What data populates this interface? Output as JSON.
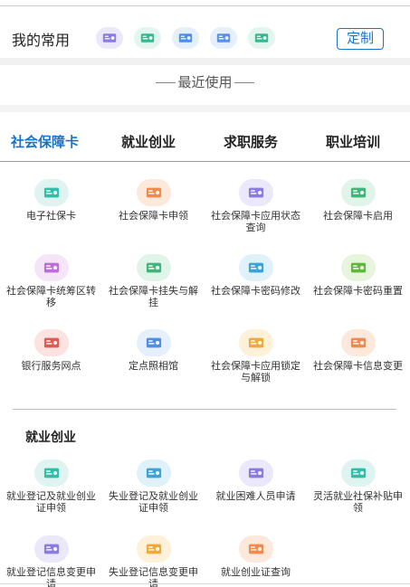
{
  "favorites": {
    "title": "我的常用",
    "custom_label": "定制",
    "icons": [
      {
        "name": "id-card-search-icon",
        "bg": "#ece8fb",
        "fg": "#8a7be0"
      },
      {
        "name": "edit-card-icon",
        "bg": "#e2f5ef",
        "fg": "#39b58f"
      },
      {
        "name": "certificate-icon",
        "bg": "#e6effc",
        "fg": "#4c8ee8"
      },
      {
        "name": "printer-icon",
        "bg": "#e6effc",
        "fg": "#5a8fe6"
      },
      {
        "name": "id-card-icon",
        "bg": "#e2f5ef",
        "fg": "#39b58f"
      }
    ]
  },
  "recent": {
    "title": "最近使用"
  },
  "tabs": [
    {
      "label": "社会保障卡",
      "active": true
    },
    {
      "label": "就业创业",
      "active": false
    },
    {
      "label": "求职服务",
      "active": false
    },
    {
      "label": "职业培训",
      "active": false
    }
  ],
  "social_card_items": [
    {
      "label": "电子社保卡",
      "icon": "e-social-card-icon",
      "bg": "#dff4f1",
      "fg": "#2dbfa8"
    },
    {
      "label": "社会保障卡申领",
      "icon": "card-apply-icon",
      "bg": "#fde8dc",
      "fg": "#f28a4c"
    },
    {
      "label": "社会保障卡应用状态查询",
      "icon": "card-status-search-icon",
      "bg": "#ece8fb",
      "fg": "#8a7be0"
    },
    {
      "label": "社会保障卡启用",
      "icon": "card-activate-icon",
      "bg": "#e1f4ea",
      "fg": "#3fb57a"
    },
    {
      "label": "社会保障卡统筹区转移",
      "icon": "card-transfer-icon",
      "bg": "#f4e5f8",
      "fg": "#c06bdc"
    },
    {
      "label": "社会保障卡挂失与解挂",
      "icon": "card-report-loss-icon",
      "bg": "#e1f4ea",
      "fg": "#3fb57a"
    },
    {
      "label": "社会保障卡密码修改",
      "icon": "password-edit-icon",
      "bg": "#dff1f9",
      "fg": "#3aa3d8"
    },
    {
      "label": "社会保障卡密码重置",
      "icon": "password-reset-icon",
      "bg": "#e7f5df",
      "fg": "#5fb83c"
    },
    {
      "label": "银行服务网点",
      "icon": "bank-icon",
      "bg": "#fce3e1",
      "fg": "#e0594f"
    },
    {
      "label": "定点照相馆",
      "icon": "photo-studio-icon",
      "bg": "#e6effc",
      "fg": "#4c8ee8"
    },
    {
      "label": "社会保障卡应用锁定与解锁",
      "icon": "card-lock-icon",
      "bg": "#fdf1d9",
      "fg": "#f0a93a"
    },
    {
      "label": "社会保障卡信息变更",
      "icon": "card-info-change-icon",
      "bg": "#fde8dc",
      "fg": "#f28a4c"
    }
  ],
  "employment_section": {
    "title": "就业创业",
    "items": [
      {
        "label": "就业登记及就业创业证申领",
        "icon": "employment-register-icon",
        "bg": "#dff4f1",
        "fg": "#2dbfa8"
      },
      {
        "label": "失业登记及就业创业证申领",
        "icon": "unemployment-register-icon",
        "bg": "#dff1f9",
        "fg": "#3aa3d8"
      },
      {
        "label": "就业困难人员申请",
        "icon": "difficulty-apply-icon",
        "bg": "#ece8fb",
        "fg": "#8a7be0"
      },
      {
        "label": "灵活就业社保补贴申领",
        "icon": "subsidy-icon",
        "bg": "#dff4f1",
        "fg": "#2dbfa8"
      },
      {
        "label": "就业登记信息变更申请",
        "icon": "employment-info-change-icon",
        "bg": "#ece8fb",
        "fg": "#8a7be0"
      },
      {
        "label": "失业登记信息变更申请",
        "icon": "unemployment-info-change-icon",
        "bg": "#fdf1d9",
        "fg": "#f0a93a"
      },
      {
        "label": "就业创业证查询",
        "icon": "certificate-search-icon",
        "bg": "#fde8dc",
        "fg": "#f28a4c"
      }
    ]
  }
}
